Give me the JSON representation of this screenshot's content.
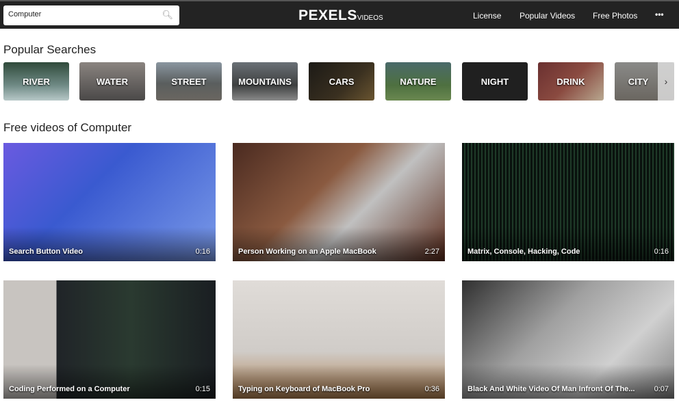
{
  "header": {
    "search_value": "Computer",
    "search_icon": "magnifier",
    "logo": "PEXELS",
    "logo_sub": "VIDEOS",
    "nav": [
      "License",
      "Popular Videos",
      "Free Photos"
    ],
    "more": "•••"
  },
  "popular": {
    "title": "Popular Searches",
    "items": [
      "RIVER",
      "WATER",
      "STREET",
      "MOUNTAINS",
      "CARS",
      "NATURE",
      "NIGHT",
      "DRINK",
      "CITY"
    ],
    "next": "›"
  },
  "videos": {
    "title": "Free videos of Computer",
    "items": [
      {
        "title": "Search Button Video",
        "duration": "0:16"
      },
      {
        "title": "Person Working on an Apple MacBook",
        "duration": "2:27"
      },
      {
        "title": "Matrix, Console, Hacking, Code",
        "duration": "0:16"
      },
      {
        "title": "Coding Performed on a Computer",
        "duration": "0:15"
      },
      {
        "title": "Typing on Keyboard of MacBook Pro",
        "duration": "0:36"
      },
      {
        "title": "Black And White Video Of Man Infront Of The...",
        "duration": "0:07"
      }
    ]
  }
}
